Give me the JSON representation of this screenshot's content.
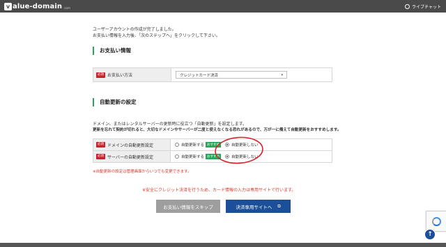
{
  "header": {
    "logo_badge": "v",
    "logo_text": "alue-domain",
    "logo_small": ".com",
    "livechat": "ライブチャット"
  },
  "intro": {
    "line1": "ユーザーアカウントの作成が完了しました。",
    "line2": "お支払い情報を入力後、「次のステップへ」をクリックして下さい。"
  },
  "payment": {
    "title": "お支払い情報",
    "required": "必須",
    "label": "お支払い方法",
    "selected": "クレジットカード決済",
    "caret": "▾"
  },
  "auto_renew": {
    "title": "自動更新の設定",
    "desc1": "ドメイン、またはレンタルサーバーの更新時に役立つ「自動更新」を設定します。",
    "desc2": "更新を忘れて契約が切れると、大切なドメインやサーバーが二度と使えなくなる恐れがあるので、万が一に備えて自動更新をおすすめします。",
    "required": "必須",
    "rows": [
      {
        "label": "ドメインの自動更新設定",
        "opt_on": "自動更新する",
        "badge": "おすすめ",
        "opt_off": "自動更新しない"
      },
      {
        "label": "サーバーの自動更新設定",
        "opt_on": "自動更新する",
        "badge": "おすすめ",
        "opt_off": "自動更新しない"
      }
    ],
    "note": "※自動更新の設定は管理画面からいつでも変更できます。"
  },
  "notice": "※安全にクレジット決済を行うため、カード情報の入力は専用サイトで行います。",
  "buttons": {
    "skip": "お支払い情報をスキップ",
    "pay": "決済専用サイトへ",
    "ext_icon": "⧉"
  },
  "scroll_top": "↑",
  "colors": {
    "header": "#4a4a4a",
    "accent_green": "#29a55a",
    "required_red": "#c8232d",
    "note_red": "#d63a2f",
    "primary_blue": "#1b4f99",
    "annotation_red": "#d9202a"
  }
}
